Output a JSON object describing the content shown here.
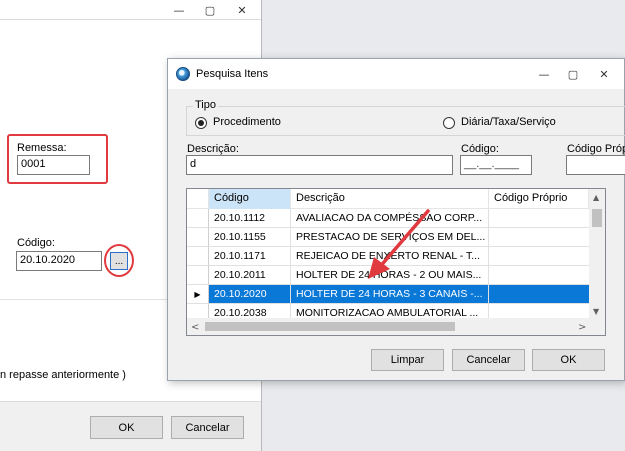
{
  "background_window": {
    "minimize_glyph": "—",
    "maximize_glyph": "▢",
    "close_glyph": "✕",
    "remessa_label": "Remessa:",
    "remessa_value": "0001",
    "codigo_label": "Código:",
    "codigo_value": "20.10.2020",
    "ellipsis_label": "...",
    "partial_text": "n repasse anteriormente )",
    "ok_label": "OK",
    "cancel_label": "Cancelar"
  },
  "dialog": {
    "title": "Pesquisa Itens",
    "minimize_glyph": "—",
    "maximize_glyph": "▢",
    "close_glyph": "✕",
    "tipo_label": "Tipo",
    "radio_procedimento": "Procedimento",
    "radio_diaria": "Diária/Taxa/Serviço",
    "descricao_label": "Descrição:",
    "descricao_value": "d",
    "codigo_label": "Código:",
    "codigo_value": "__.__.____",
    "codigo_proprio_label": "Código Próp",
    "grid": {
      "columns": [
        "Código",
        "Descrição",
        "Código Próprio"
      ],
      "rows": [
        {
          "codigo": "20.10.1112",
          "descricao": "AVALIACAO DA COMPÉSSAO CORP...",
          "proprio": ""
        },
        {
          "codigo": "20.10.1155",
          "descricao": "PRESTACAO DE SERVIÇOS EM DEL...",
          "proprio": ""
        },
        {
          "codigo": "20.10.1171",
          "descricao": "REJEICAO DE ENXERTO RENAL - T...",
          "proprio": ""
        },
        {
          "codigo": "20.10.2011",
          "descricao": "HOLTER DE 24 HORAS - 2 OU MAIS...",
          "proprio": ""
        },
        {
          "codigo": "20.10.2020",
          "descricao": "HOLTER DE 24 HORAS - 3 CANAIS -...",
          "proprio": ""
        },
        {
          "codigo": "20.10.2038",
          "descricao": "MONITORIZACAO AMBULATORIAL ...",
          "proprio": ""
        }
      ],
      "selected_row_marker": "▶"
    },
    "limpar_label": "Limpar",
    "cancelar_label": "Cancelar",
    "ok_label": "OK"
  },
  "colors": {
    "accent_red": "#e0393e",
    "selection_blue": "#0a78d7"
  }
}
